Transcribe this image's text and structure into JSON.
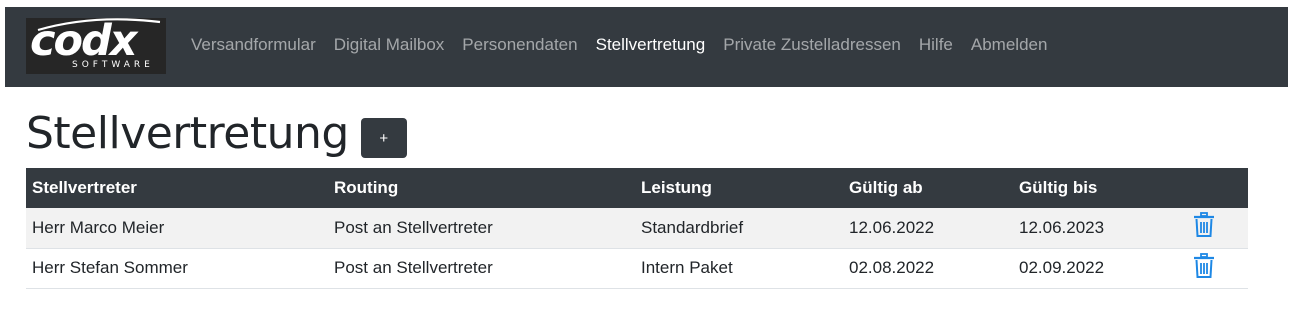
{
  "brand": {
    "name": "codx",
    "subtitle": "SOFTWARE"
  },
  "nav": {
    "items": [
      {
        "label": "Versandformular",
        "active": false
      },
      {
        "label": "Digital Mailbox",
        "active": false
      },
      {
        "label": "Personendaten",
        "active": false
      },
      {
        "label": "Stellvertretung",
        "active": true
      },
      {
        "label": "Private Zustelladressen",
        "active": false
      },
      {
        "label": "Hilfe",
        "active": false
      },
      {
        "label": "Abmelden",
        "active": false
      }
    ]
  },
  "page": {
    "title": "Stellvertretung",
    "add_label": "+"
  },
  "table": {
    "headers": [
      "Stellvertreter",
      "Routing",
      "Leistung",
      "Gültig ab",
      "Gültig bis"
    ],
    "rows": [
      {
        "stellvertreter": "Herr Marco Meier",
        "routing": "Post an Stellvertreter",
        "leistung": "Standardbrief",
        "gueltig_ab": "12.06.2022",
        "gueltig_bis": "12.06.2023",
        "action_icon": "trash-icon"
      },
      {
        "stellvertreter": "Herr Stefan Sommer",
        "routing": "Post an Stellvertreter",
        "leistung": "Intern Paket",
        "gueltig_ab": "02.08.2022",
        "gueltig_bis": "02.09.2022",
        "action_icon": "trash-icon"
      }
    ]
  },
  "colors": {
    "navbar": "#343a40",
    "trash": "#1e88e5"
  }
}
